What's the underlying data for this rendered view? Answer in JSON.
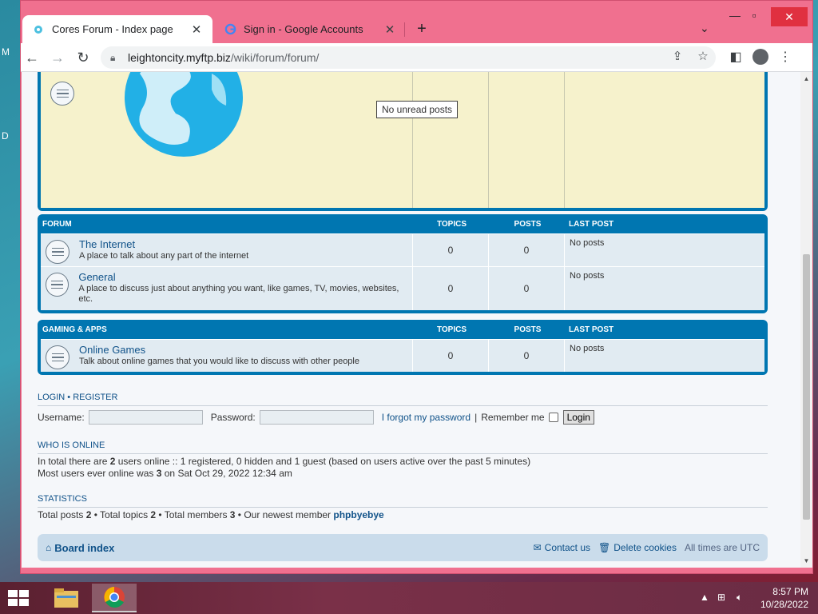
{
  "browser": {
    "tabs": [
      {
        "title": "Cores Forum - Index page",
        "active": true
      },
      {
        "title": "Sign in - Google Accounts",
        "active": false
      }
    ],
    "url_host": "leightoncity.myftp.biz",
    "url_path": "/wiki/forum/forum/"
  },
  "tooltip": "No unread posts",
  "categories": [
    {
      "title": "FORUM",
      "col_topics": "TOPICS",
      "col_posts": "POSTS",
      "col_last": "LAST POST",
      "forums": [
        {
          "name": "The Internet",
          "desc": "A place to talk about any part of the internet",
          "topics": "0",
          "posts": "0",
          "last": "No posts"
        },
        {
          "name": "General",
          "desc": "A place to discuss just about anything you want, like games, TV, movies, websites, etc.",
          "topics": "0",
          "posts": "0",
          "last": "No posts"
        }
      ]
    },
    {
      "title": "GAMING & APPS",
      "col_topics": "TOPICS",
      "col_posts": "POSTS",
      "col_last": "LAST POST",
      "forums": [
        {
          "name": "Online Games",
          "desc": "Talk about online games that you would like to discuss with other people",
          "topics": "0",
          "posts": "0",
          "last": "No posts"
        }
      ]
    }
  ],
  "login": {
    "login_link": "LOGIN",
    "sep": "•",
    "register_link": "REGISTER",
    "username_label": "Username:",
    "password_label": "Password:",
    "forgot_link": "I forgot my password",
    "pipe": "|",
    "remember_label": "Remember me",
    "button": "Login"
  },
  "online": {
    "title": "WHO IS ONLINE",
    "line1_a": "In total there are ",
    "line1_b": "2",
    "line1_c": " users online :: 1 registered, 0 hidden and 1 guest (based on users active over the past 5 minutes)",
    "line2_a": "Most users ever online was ",
    "line2_b": "3",
    "line2_c": " on Sat Oct 29, 2022 12:34 am"
  },
  "stats": {
    "title": "STATISTICS",
    "a": "Total posts ",
    "posts": "2",
    "b": " • Total topics ",
    "topics": "2",
    "c": " • Total members ",
    "members": "3",
    "d": " • Our newest member ",
    "newest": "phpbyebye"
  },
  "footer": {
    "board_index": "Board index",
    "contact": "Contact us",
    "delete_cookies": "Delete cookies",
    "timezone": "All times are UTC"
  },
  "taskbar": {
    "time": "8:57 PM",
    "date": "10/28/2022"
  },
  "desktop": {
    "letter_m": "M",
    "letter_d": "D"
  }
}
